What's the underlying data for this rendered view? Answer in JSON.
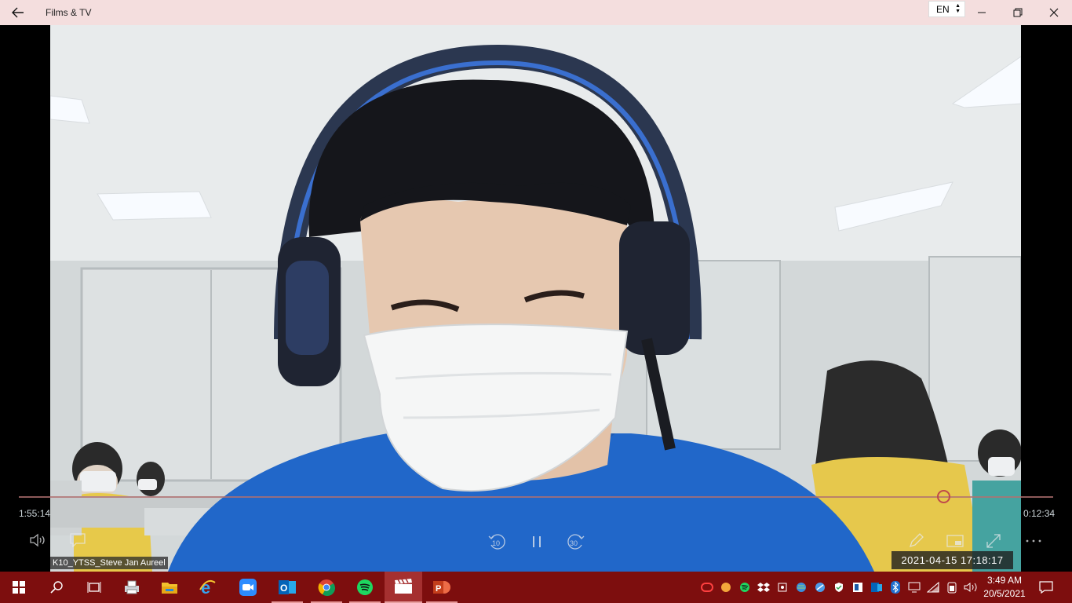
{
  "window": {
    "title": "Films & TV",
    "language": "EN",
    "icons": {
      "back": "back-arrow-icon",
      "minimize": "minimize-icon",
      "maximize": "restore-icon",
      "close": "close-icon"
    }
  },
  "player": {
    "elapsed": "1:55:14",
    "remaining": "0:12:34",
    "progress_fraction": 0.9,
    "participant_name": "K10_YTSS_Steve Jan Aureel",
    "video_timestamp": "2021-04-15  17:18:17",
    "controls": {
      "volume": "volume-icon",
      "subtitles": "subtitles-icon",
      "skip_back": "10",
      "play_pause": "pause-icon",
      "skip_forward": "30",
      "edit": "pencil-icon",
      "mini_view": "mini-view-icon",
      "fullscreen": "fullscreen-icon",
      "more": "more-icon"
    }
  },
  "taskbar": {
    "color": "#7d0e0e",
    "apps": [
      "start-icon",
      "search-icon",
      "task-view-icon",
      "printer-icon",
      "file-explorer-icon",
      "internet-explorer-icon",
      "zoom-icon",
      "outlook-icon",
      "chrome-icon",
      "spotify-icon",
      "films-tv-icon",
      "powerpoint-icon"
    ],
    "clock": {
      "time": "3:49 AM",
      "date": "20/5/2021"
    }
  }
}
